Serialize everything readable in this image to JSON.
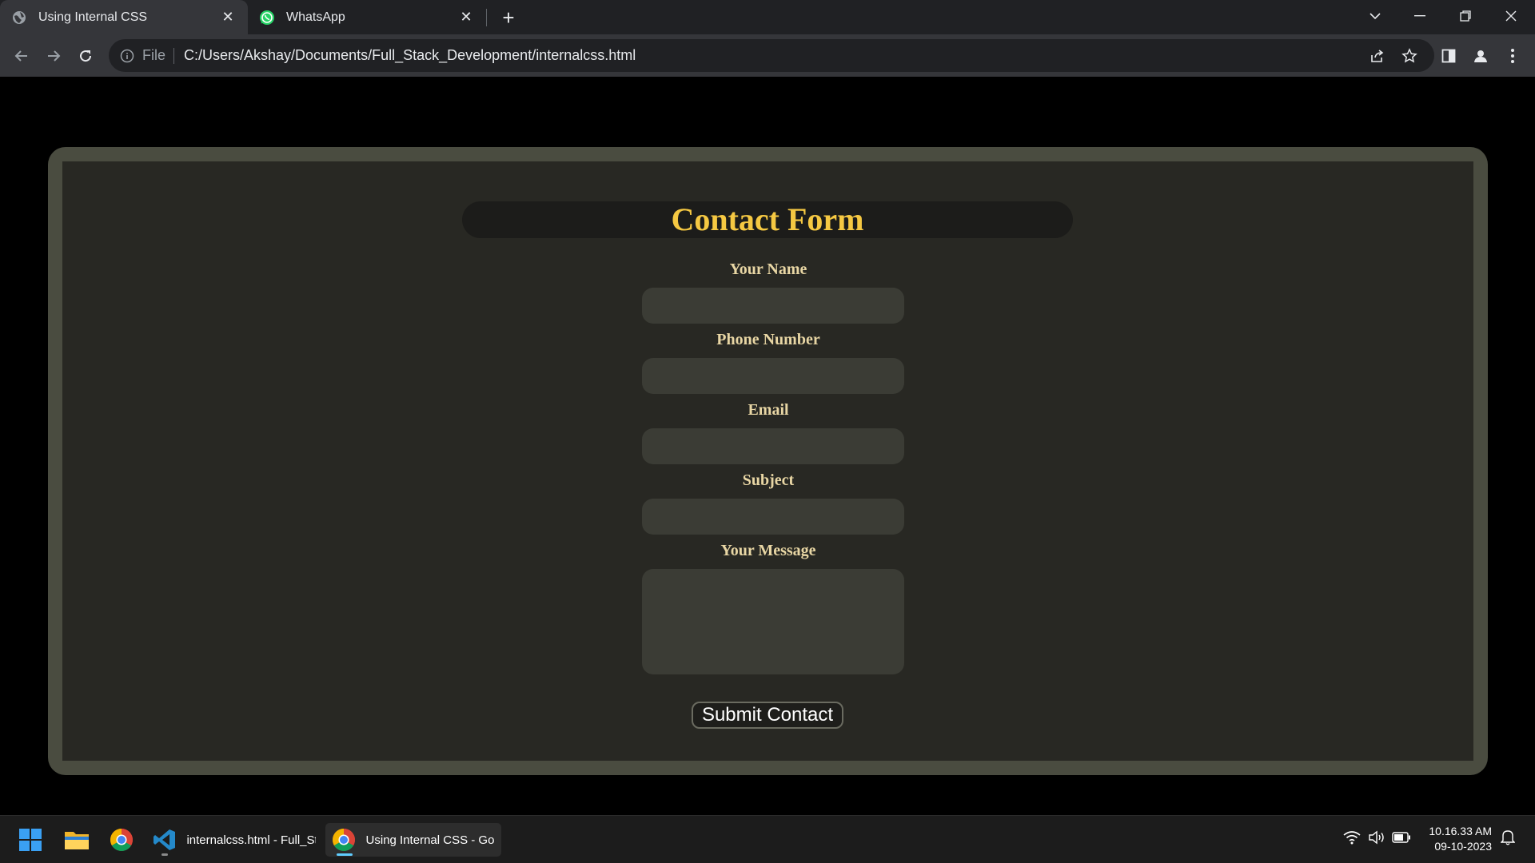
{
  "browser": {
    "tabs": [
      {
        "title": "Using Internal CSS",
        "icon": "globe-icon",
        "active": true
      },
      {
        "title": "WhatsApp",
        "icon": "whatsapp-icon",
        "active": false
      }
    ],
    "address": {
      "scheme": "File",
      "url": "C:/Users/Akshay/Documents/Full_Stack_Development/internalcss.html"
    }
  },
  "page": {
    "title": "Contact Form",
    "fields": [
      {
        "label": "Your Name",
        "value": ""
      },
      {
        "label": "Phone Number",
        "value": ""
      },
      {
        "label": "Email",
        "value": ""
      },
      {
        "label": "Subject",
        "value": ""
      },
      {
        "label": "Your Message",
        "value": ""
      }
    ],
    "submit_label": "Submit Contact"
  },
  "taskbar": {
    "apps": [
      {
        "name": "start",
        "icon": "windows-start-icon"
      },
      {
        "name": "file-explorer",
        "icon": "folder-icon"
      },
      {
        "name": "chrome",
        "icon": "chrome-icon"
      },
      {
        "name": "vscode",
        "icon": "vscode-icon",
        "label": "internalcss.html - Full_St"
      },
      {
        "name": "chrome-window",
        "icon": "chrome-icon",
        "label": "Using Internal CSS - Goo"
      }
    ],
    "clock": {
      "time": "10.16.33 AM",
      "date": "09-10-2023"
    }
  },
  "colors": {
    "title": "#f5c842",
    "label": "#e8d6a4",
    "frame": "#4a4c40",
    "panel": "#282823",
    "input": "#3b3c35"
  }
}
